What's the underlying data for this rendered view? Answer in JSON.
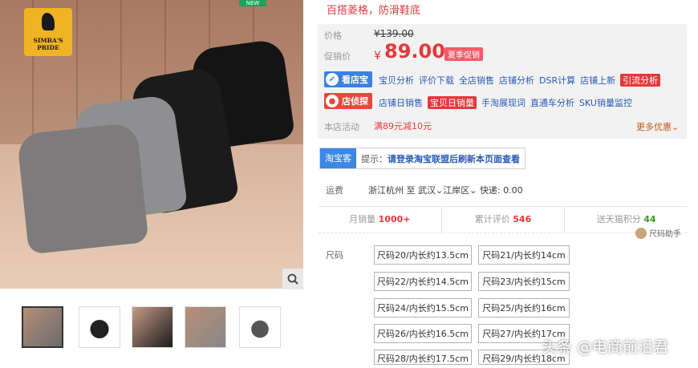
{
  "badge_new": "NEW",
  "logo": {
    "line1": "SIMBA'S PRIDE"
  },
  "subtitle": "百搭菱格，防滑鞋底",
  "price": {
    "orig_label": "价格",
    "orig_value": "¥139.00",
    "promo_label": "促销价",
    "yen": "¥",
    "promo_value": "89.00",
    "promo_tag": "夏季促销"
  },
  "tools": {
    "kandianbao": {
      "label": "看店宝",
      "links": [
        "宝贝分析",
        "评价下载",
        "全店销售",
        "店铺分析",
        "DSR计算",
        "店铺上新"
      ],
      "highlight": "引流分析"
    },
    "diantan": {
      "label": "店侦探",
      "links_before": [
        "店铺日销售"
      ],
      "highlight": "宝贝日销量",
      "links_after": [
        "手淘展现词",
        "直通车分析",
        "SKU销量监控"
      ]
    }
  },
  "activity": {
    "label": "本店活动",
    "value": "满89元减10元",
    "more": "更多优惠"
  },
  "taobaoke": {
    "tag": "淘宝客",
    "prefix": "提示：",
    "text": "请登录淘宝联盟后刷新本页面查看"
  },
  "shipping": {
    "label": "运费",
    "from": "浙江杭州",
    "to_word": "至",
    "city": "武汉",
    "district": "江岸区",
    "fee": "快递: 0.00"
  },
  "stats": [
    {
      "label": "月销量",
      "value": "1000+"
    },
    {
      "label": "累计评价",
      "value": "546"
    },
    {
      "label": "送天猫积分",
      "value": "44"
    }
  ],
  "size_helper": "尺码助手",
  "size_label": "尺码",
  "sizes": [
    "尺码20/内长约13.5cm",
    "尺码21/内长约14cm",
    "尺码22/内长约14.5cm",
    "尺码23/内长约15cm",
    "尺码24/内长约15.5cm",
    "尺码25/内长约16cm",
    "尺码26/内长约16.5cm",
    "尺码27/内长约17cm",
    "尺码28/内长约17.5cm",
    "尺码29/内长约18cm"
  ],
  "watermark": "头条 @电商前沿君",
  "icons": {
    "zoom": "magnifier-icon",
    "kandianbao": "v-icon",
    "diantan": "person-icon",
    "more": "chevron-down-icon",
    "helper": "coin-icon"
  }
}
